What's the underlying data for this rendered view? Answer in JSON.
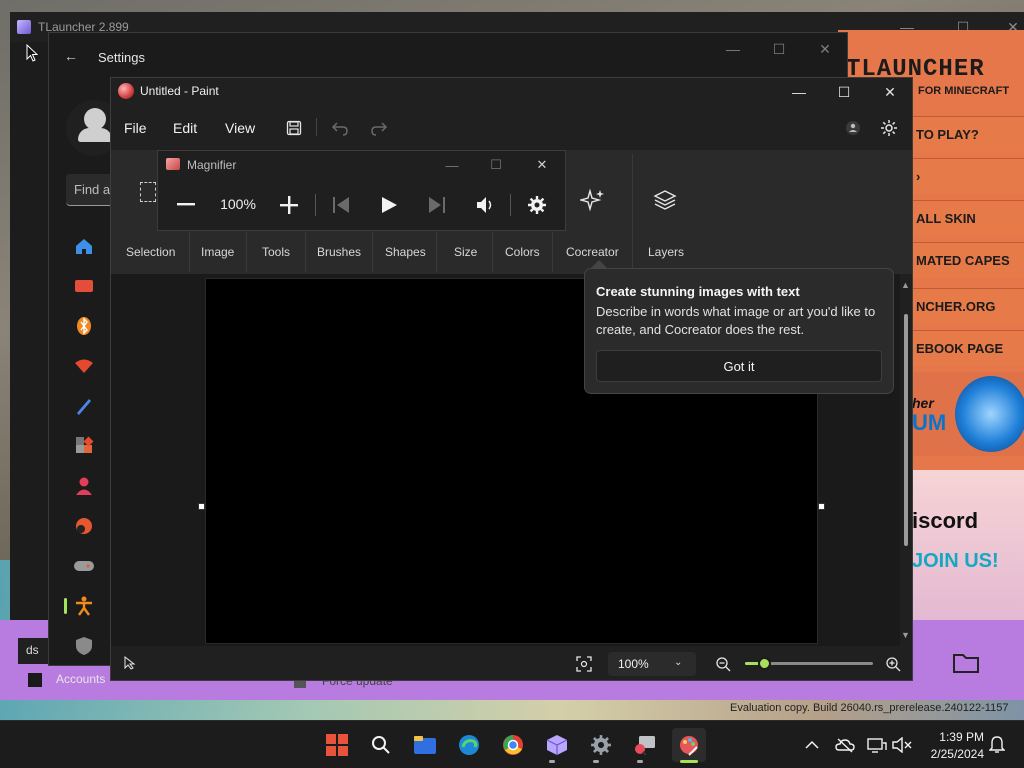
{
  "colors": {
    "accent_green": "#a9e05a",
    "paint_bg": "#202020",
    "tlauncher_orange": "#e67a48"
  },
  "tlauncher": {
    "title": "TLauncher 2.899",
    "logo": "TLAUNCHER",
    "logo_sub": "FOR MINECRAFT",
    "menu": [
      "TO PLAY?",
      "",
      "ALL SKIN",
      "MATED CAPES",
      "NCHER.ORG",
      "EBOOK PAGE"
    ],
    "forum_small": "her",
    "forum_big": "UM",
    "discord": "iscord",
    "join": "JOIN US!",
    "bottom_left": "ds",
    "bottom_mid": "Force update"
  },
  "settings": {
    "title": "Settings",
    "find_placeholder": "Find a",
    "accounts": "Accounts",
    "nav_icons": [
      "home-icon",
      "system-icon",
      "bluetooth-icon",
      "network-icon",
      "personalization-icon",
      "apps-icon",
      "accounts-icon",
      "time-language-icon",
      "gaming-icon",
      "accessibility-icon",
      "privacy-security-icon"
    ]
  },
  "paint": {
    "title": "Untitled - Paint",
    "menu": {
      "file": "File",
      "edit": "Edit",
      "view": "View"
    },
    "ribbon": {
      "selection": "Selection",
      "image": "Image",
      "tools": "Tools",
      "brushes": "Brushes",
      "shapes": "Shapes",
      "size": "Size",
      "colors": "Colors",
      "cocreator": "Cocreator",
      "layers": "Layers"
    },
    "zoom": "100%",
    "zoom_slider_fraction": 0.1
  },
  "magnifier": {
    "title": "Magnifier",
    "zoom": "100%"
  },
  "cocreator_tip": {
    "title": "Create stunning images with text",
    "description": "Describe in words what image or art you'd like to create, and Cocreator does the rest.",
    "button": "Got it"
  },
  "watermark": "Evaluation copy. Build 26040.rs_prerelease.240122-1157",
  "taskbar": {
    "apps": [
      "start-icon",
      "search-icon",
      "file-explorer-icon",
      "edge-icon",
      "chrome-icon",
      "tlauncher-icon",
      "settings-icon",
      "magnifier-icon",
      "paint-icon"
    ],
    "time": "1:39 PM",
    "date": "2/25/2024"
  }
}
